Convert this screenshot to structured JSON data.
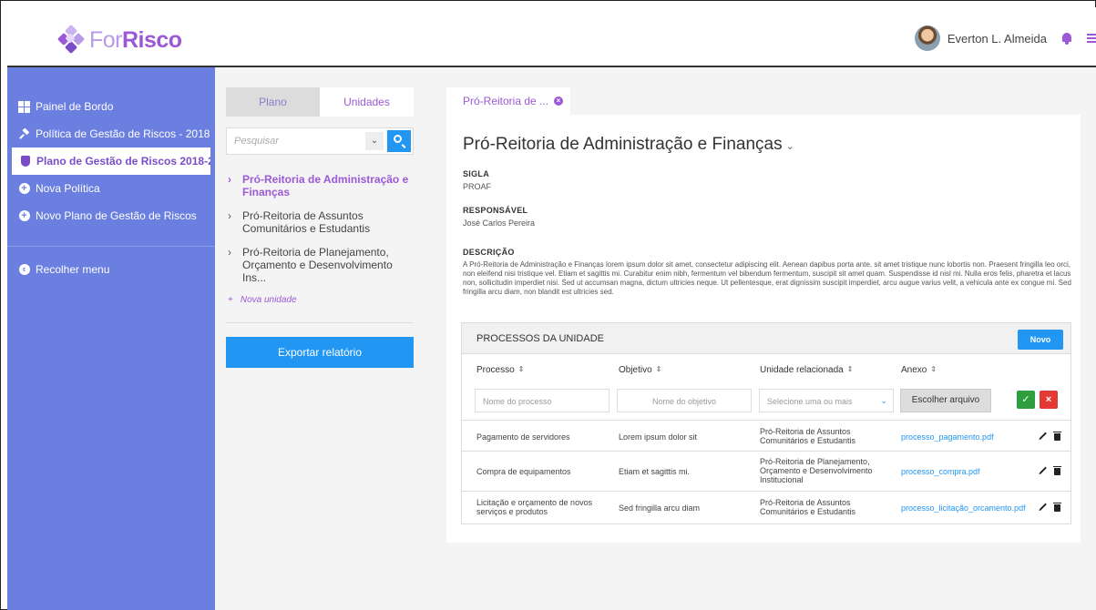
{
  "brand": {
    "name_part1": "For",
    "name_part2": "Risco"
  },
  "user": {
    "name": "Everton L. Almeida"
  },
  "icons": {
    "bell": "bell-icon",
    "menu": "hamburger-icon",
    "search": "search-icon",
    "chevron": "chevron-down-icon"
  },
  "colors": {
    "sidebar": "#6b7fe0",
    "accent": "#9b59d6",
    "primary": "#2196f3",
    "success": "#2e9e3e",
    "danger": "#e53935"
  },
  "sidebar": {
    "items": [
      {
        "label": "Painel de Bordo"
      },
      {
        "label": "Política de Gestão de Riscos - 2018"
      },
      {
        "label": "Plano de Gestão de Riscos 2018-2..."
      },
      {
        "label": "Nova Política"
      },
      {
        "label": "Novo Plano de Gestão de Riscos"
      }
    ],
    "collapse_label": "Recolher menu"
  },
  "midpanel": {
    "tabs": [
      {
        "label": "Plano"
      },
      {
        "label": "Unidades"
      }
    ],
    "search_placeholder": "Pesquisar",
    "units": [
      {
        "label": "Pró-Reitoria de Administração e Finanças"
      },
      {
        "label": "Pró-Reitoria de Assuntos Comunitários e Estudantis"
      },
      {
        "label": "Pró-Reitoria de Planejamento, Orçamento e Desenvolvimento Ins..."
      }
    ],
    "new_unit_label": "Nova unidade",
    "export_label": "Exportar relatório"
  },
  "main": {
    "open_tab": "Pró-Reitoria de ...",
    "title": "Pró-Reitoria de Administração e Finanças",
    "sigla_label": "SIGLA",
    "sigla_value": "PROAF",
    "responsavel_label": "RESPONSÁVEL",
    "responsavel_value": "José Carlos Pereira",
    "descricao_label": "DESCRIÇÃO",
    "descricao_value": "A Pró-Reitoria de Administração e Finanças lorem ipsum dolor sit amet, consectetur adipiscing elit. Aenean dapibus porta ante, sit amet tristique nunc lobortis non. Praesent fringilla leo orci, non eleifend nisi tristique vel. Etiam et sagittis mi. Curabitur enim nibh, fermentum vel bibendum fermentum, suscipit sit amet quam. Suspendisse id nisl mi. Nulla eros felis, pharetra et lacus non, sollicitudin imperdiet nisi. Sed ut accumsan magna, dictum ultricies neque. Ut pellentesque, erat dignissim suscipit imperdiet, arcu augue varius velit, a vehicula ante ex congue mi. Sed fringilla arcu diam, non blandit est ultricies sed."
  },
  "processes": {
    "title": "PROCESSOS DA UNIDADE",
    "new_label": "Novo",
    "columns": [
      "Processo",
      "Objetivo",
      "Unidade relacionada",
      "Anexo"
    ],
    "new_row": {
      "process_placeholder": "Nome do processo",
      "objective_placeholder": "Nome do objetivo",
      "unit_placeholder": "Selecione uma ou mais",
      "file_label": "Escolher arquivo"
    },
    "rows": [
      {
        "process": "Pagamento de servidores",
        "objective": "Lorem ipsum dolor sit",
        "unit": "Pró-Reitoria de Assuntos Comunitários e Estudantis",
        "file": "processo_pagamento.pdf"
      },
      {
        "process": "Compra de equipamentos",
        "objective": "Etiam et sagittis mi.",
        "unit": "Pró-Reitoria de Planejamento, Orçamento e Desenvolvimento Institucional",
        "file": "processo_compra.pdf"
      },
      {
        "process": "Licitação e orçamento de novos serviços e produtos",
        "objective": "Sed fringilla arcu diam",
        "unit": "Pró-Reitoria de Assuntos Comunitários e Estudantis",
        "file": "processo_licitação_orcamento.pdf"
      }
    ]
  }
}
